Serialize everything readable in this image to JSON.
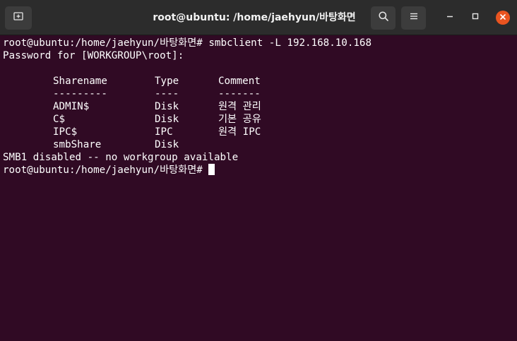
{
  "window": {
    "title": "root@ubuntu: /home/jaehyun/바탕화면",
    "buttons": {
      "new_tab_icon": "new-tab-icon",
      "search_icon": "search-icon",
      "menu_icon": "hamburger-menu-icon",
      "minimize_icon": "minimize-icon",
      "maximize_icon": "maximize-icon",
      "close_icon": "close-icon"
    },
    "colors": {
      "terminal_bg": "#300a24",
      "titlebar_bg": "#2c2c2c",
      "close_accent": "#e95420",
      "text": "#ffffff"
    }
  },
  "terminal": {
    "command_line": "root@ubuntu:/home/jaehyun/바탕화면# smbclient -L 192.168.10.168",
    "password_prompt": "Password for [WORKGROUP\\root]:",
    "table": {
      "headers": [
        "Sharename",
        "Type",
        "Comment"
      ],
      "separators": [
        "---------",
        "----",
        "-------"
      ],
      "rows": [
        [
          "ADMIN$",
          "Disk",
          "원격 관리"
        ],
        [
          "C$",
          "Disk",
          "기본 공유"
        ],
        [
          "IPC$",
          "IPC",
          "원격 IPC"
        ],
        [
          "smbShare",
          "Disk",
          ""
        ]
      ]
    },
    "status_line": "SMB1 disabled -- no workgroup available",
    "prompt_line": "root@ubuntu:/home/jaehyun/바탕화면# "
  }
}
